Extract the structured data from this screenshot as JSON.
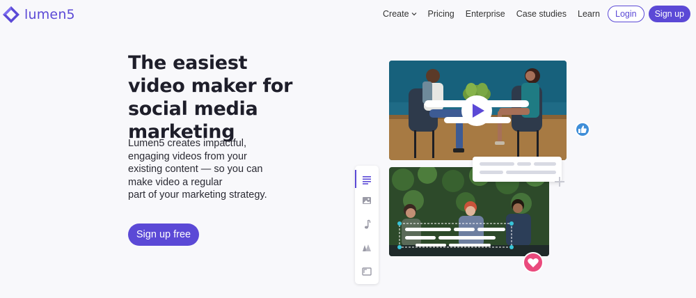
{
  "brand": {
    "name": "lumen5",
    "color": "#5b49d6"
  },
  "nav": {
    "links": [
      "Create",
      "Pricing",
      "Enterprise",
      "Case studies",
      "Learn"
    ],
    "login_label": "Login",
    "signup_label": "Sign up"
  },
  "hero": {
    "title": "The easiest video maker for social media marketing",
    "description_lines": [
      "Lumen5 creates impactful,",
      "engaging videos from your",
      "existing content — so you can",
      "make video a regular",
      "part of your marketing strategy."
    ],
    "cta_label": "Sign up free"
  },
  "illustration": {
    "toolbar_icons": [
      "text-icon",
      "image-icon",
      "music-icon",
      "style-icon",
      "format-icon"
    ],
    "badges": {
      "like": "thumbs-up-icon",
      "love": "heart-icon"
    }
  }
}
